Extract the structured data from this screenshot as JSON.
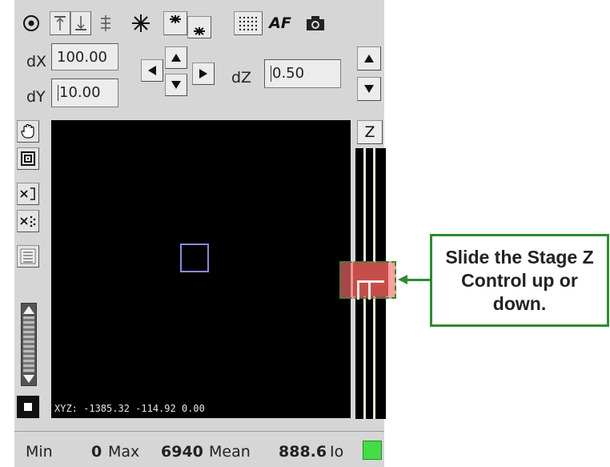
{
  "toolbar": {
    "af_label": "AF"
  },
  "stage": {
    "dx_label": "dX",
    "dx_value": "100.00",
    "dy_label": "dY",
    "dy_value": "10.00",
    "dz_label": "dZ",
    "dz_value": "0.50"
  },
  "z_button_label": "Z",
  "viewer": {
    "xyz_readout": "XYZ: -1385.32 -114.92 0.00"
  },
  "status": {
    "min_label": "Min",
    "min_value": "0",
    "max_label": "Max",
    "max_value": "6940",
    "mean_label": "Mean",
    "mean_value": "888.6",
    "io_label": "Io",
    "indicator_color": "#44dd44"
  },
  "callout": {
    "text": "Slide the Stage Z Control up or down."
  },
  "colors": {
    "callout_border": "#2e8b2e",
    "highlight": "#ff6e6e",
    "roi": "#8a8ad8"
  }
}
